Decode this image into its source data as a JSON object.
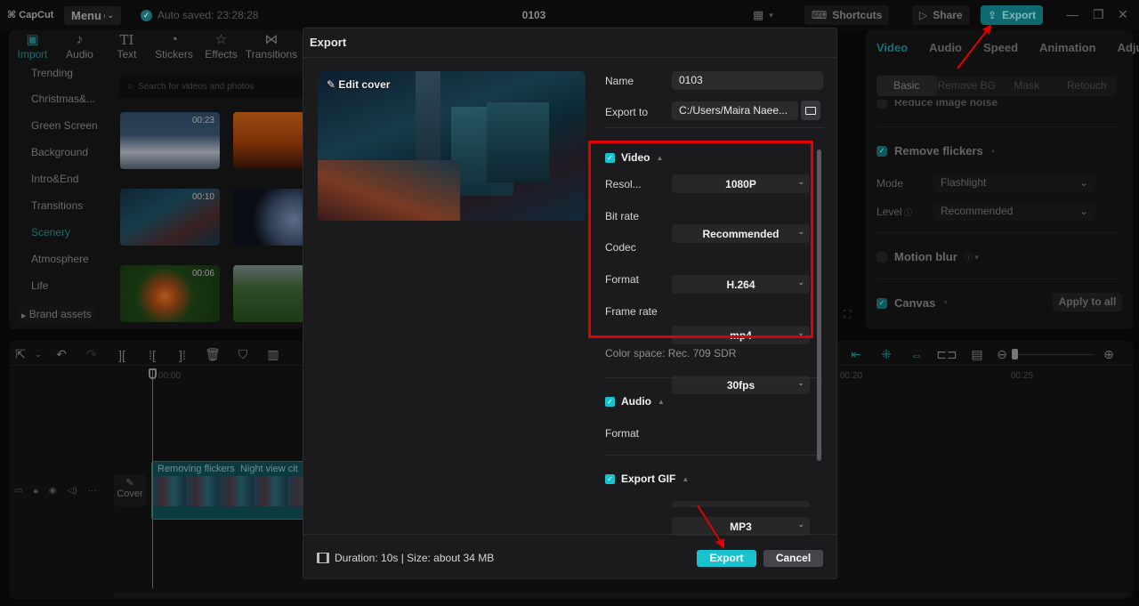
{
  "app": {
    "logo": "CapCut",
    "menu_label": "Menu",
    "autosave": "Auto saved: 23:28:28",
    "project_title": "0103",
    "shortcuts_label": "Shortcuts",
    "share_label": "Share",
    "export_label": "Export"
  },
  "left_panel": {
    "tools": [
      {
        "label": "Import",
        "icon": "import-icon"
      },
      {
        "label": "Audio",
        "icon": "audio-icon"
      },
      {
        "label": "Text",
        "icon": "text-icon"
      },
      {
        "label": "Stickers",
        "icon": "stickers-icon"
      },
      {
        "label": "Effects",
        "icon": "effects-icon"
      },
      {
        "label": "Transitions",
        "icon": "transitions-icon"
      }
    ],
    "categories": [
      "Trending",
      "Christmas&...",
      "Green Screen",
      "Background",
      "Intro&End",
      "Transitions",
      "Scenery",
      "Atmosphere",
      "Life"
    ],
    "active_category": "Scenery",
    "brand_assets": "Brand assets",
    "search_placeholder": "Search for videos and photos",
    "thumbnails": [
      {
        "duration": "00:23",
        "subject": "clouds"
      },
      {
        "duration": "",
        "subject": "camels at sunset"
      },
      {
        "duration": "00:10",
        "subject": "night city"
      },
      {
        "duration": "",
        "subject": "earth"
      },
      {
        "duration": "00:06",
        "subject": "orange flower"
      },
      {
        "duration": "",
        "subject": "mountain forest"
      }
    ]
  },
  "right_panel": {
    "tabs": [
      "Video",
      "Audio",
      "Speed",
      "Animation",
      "Adju"
    ],
    "active_tab": "Video",
    "subtabs": [
      "Basic",
      "Remove BG",
      "Mask",
      "Retouch"
    ],
    "active_subtab": "Basic",
    "reduce_noise": "Reduce image noise",
    "remove_flickers": {
      "label": "Remove flickers",
      "checked": true
    },
    "mode_label": "Mode",
    "mode_value": "Flashlight",
    "level_label": "Level",
    "level_value": "Recommended",
    "motion_blur": {
      "label": "Motion blur",
      "checked": false
    },
    "canvas": {
      "label": "Canvas",
      "checked": true
    },
    "apply_all": "Apply to all"
  },
  "timeline": {
    "time_start": "00:00",
    "time_20": "00:20",
    "time_25": "00:25",
    "clip_label_1": "Removing flickers",
    "clip_label_2": "Night view cit",
    "cover_label": "Cover"
  },
  "dialog": {
    "title": "Export",
    "edit_cover": "Edit cover",
    "name_label": "Name",
    "name_value": "0103",
    "export_to_label": "Export to",
    "export_to_value": "C:/Users/Maira Naee...",
    "video": {
      "label": "Video",
      "checked": true,
      "rows": [
        {
          "label": "Resol...",
          "value": "1080P"
        },
        {
          "label": "Bit rate",
          "value": "Recommended"
        },
        {
          "label": "Codec",
          "value": "H.264"
        },
        {
          "label": "Format",
          "value": "mp4"
        },
        {
          "label": "Frame rate",
          "value": "30fps"
        }
      ],
      "color_space": "Color space: Rec. 709 SDR"
    },
    "audio": {
      "label": "Audio",
      "checked": true,
      "format_label": "Format",
      "format_value": "MP3"
    },
    "gif": {
      "label": "Export GIF",
      "checked": true
    },
    "footer": {
      "info": "Duration: 10s | Size: about 34 MB",
      "export_button": "Export",
      "cancel_button": "Cancel"
    }
  },
  "colors": {
    "accent": "#18c3cf",
    "highlight_box": "#e00000",
    "annotation_arrow": "#e00000"
  }
}
